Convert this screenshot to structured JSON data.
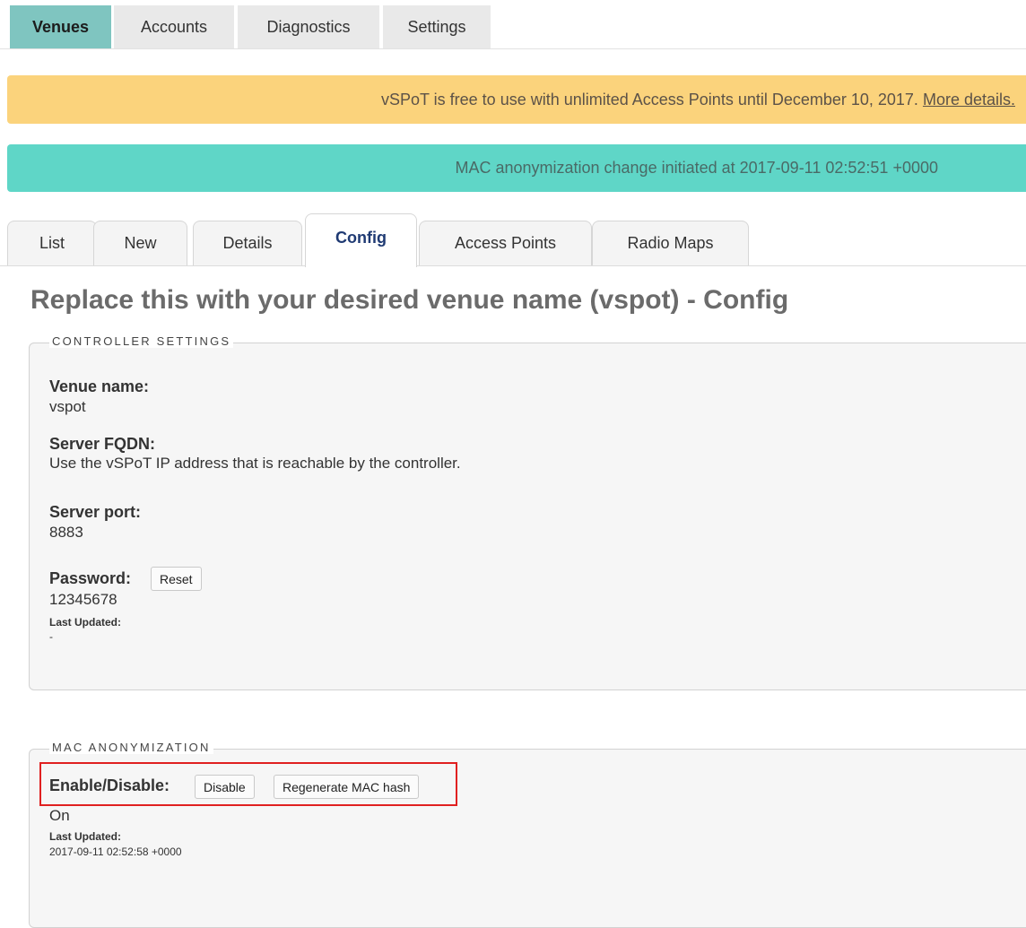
{
  "top_tabs": [
    {
      "label": "Venues",
      "active": true
    },
    {
      "label": "Accounts",
      "active": false
    },
    {
      "label": "Diagnostics",
      "active": false
    },
    {
      "label": "Settings",
      "active": false
    }
  ],
  "banners": {
    "trial_text": "vSPoT is free to use with unlimited Access Points until December 10, 2017.",
    "trial_link": "More details.",
    "status_text": "MAC anonymization change initiated at 2017-09-11 02:52:51 +0000"
  },
  "sub_tabs": [
    {
      "label": "List",
      "active": false
    },
    {
      "label": "New",
      "active": false
    },
    {
      "label": "Details",
      "active": false
    },
    {
      "label": "Config",
      "active": true
    },
    {
      "label": "Access Points",
      "active": false
    },
    {
      "label": "Radio Maps",
      "active": false
    }
  ],
  "page_title": "Replace this with your desired venue name (vspot) - Config",
  "controller_settings": {
    "legend": "CONTROLLER SETTINGS",
    "venue_name_label": "Venue name:",
    "venue_name_value": "vspot",
    "server_fqdn_label": "Server FQDN:",
    "server_fqdn_value": "Use the vSPoT IP address that is reachable by the controller.",
    "server_port_label": "Server port:",
    "server_port_value": "8883",
    "password_label": "Password:",
    "reset_button": "Reset",
    "password_value": "12345678",
    "last_updated_label": "Last Updated:",
    "last_updated_value": "-"
  },
  "mac_anonymization": {
    "legend": "MAC ANONYMIZATION",
    "enable_label": "Enable/Disable:",
    "disable_button": "Disable",
    "regenerate_button": "Regenerate MAC hash",
    "state_value": "On",
    "last_updated_label": "Last Updated:",
    "last_updated_value": "2017-09-11 02:52:58 +0000"
  },
  "colors": {
    "active_top_tab": "#7fc5c0",
    "trial_banner": "#fbd37c",
    "status_banner": "#5fd6c7",
    "active_sub_tab_text": "#1f3a73",
    "highlight_box": "#e02020"
  }
}
